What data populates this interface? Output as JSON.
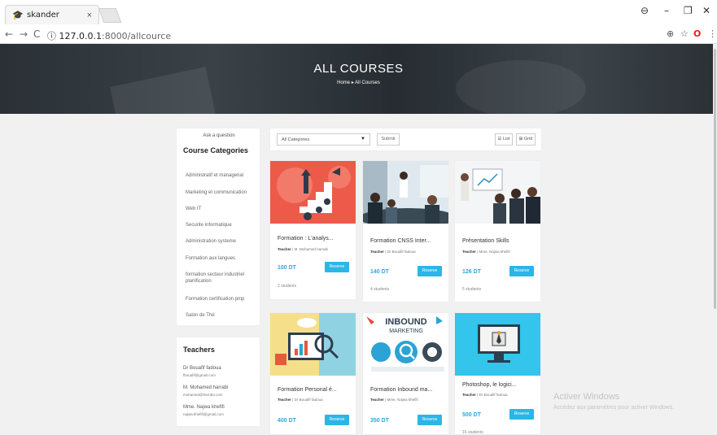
{
  "browser": {
    "tab_title": "skander",
    "tab_close": "×",
    "url_host": "127.0.0.1",
    "url_path": ":8000/allcource",
    "win_min": "–",
    "win_max": "❐",
    "win_close": "✕",
    "profile": "⊖"
  },
  "hero": {
    "title": "ALL COURSES",
    "breadcrumb_home": "Home",
    "breadcrumb_sep": "▸",
    "breadcrumb_current": "All Courses"
  },
  "sidebar": {
    "ask": "Ask a question",
    "categories_title": "Course Categories",
    "categories": [
      "Administratif et managerial",
      "Marketing et communication",
      "Web IT",
      "Securite informatique",
      "Administration systeme",
      "Formation aux langues",
      "formation secteur industriel planification",
      "Formation certification pmp",
      "Salon de Thé"
    ],
    "teachers_title": "Teachers",
    "teachers": [
      {
        "name": "Dr Bouafif fadoua",
        "email": "fbouafif@gmail.com"
      },
      {
        "name": "M. Mohamed harrabi",
        "email": "mohamed@harrabi.com"
      },
      {
        "name": "Mme. Najwa khefifi",
        "email": "najwa.khefifi@gmail.com"
      }
    ]
  },
  "filters": {
    "category_selected": "All Categories",
    "submit_label": "Submit",
    "list_label": "☰ List",
    "grid_label": "⊞ Grid"
  },
  "courses": [
    {
      "title": "Formation : L'analys...",
      "teacher": "M. Mohamed harrabi",
      "price": "100 DT",
      "students": "2 students"
    },
    {
      "title": "Formation CNSS Inter...",
      "teacher": "Dr Bouafif fadoua",
      "price": "140 DT",
      "students": "4 students"
    },
    {
      "title": "Présentation Skills",
      "teacher": "Mme. Najwa khefifi",
      "price": "126 DT",
      "students": "5 students"
    },
    {
      "title": "Formation Personal é...",
      "teacher": "Dr Bouafif fadoua",
      "price": "400 DT",
      "students": ""
    },
    {
      "title": "Formation Inbound ma...",
      "teacher": "Mme. Najwa khefifi",
      "price": "350 DT",
      "students": ""
    },
    {
      "title": "Photoshop, le logici...",
      "teacher": "Dr Bouafif fadoua",
      "price": "500 DT",
      "students": "16 students"
    }
  ],
  "course_labels": {
    "teacher_prefix": "Teacher",
    "reserve": "Reserve",
    "inbound_line1": "INBOUND",
    "inbound_line2": "MARKETING"
  },
  "windows_watermark": {
    "line1": "Activer Windows",
    "line2": "Accédez aux paramètres pour activer Windows."
  },
  "colors": {
    "accent": "#2bb6e6",
    "price": "#2aa8dc"
  }
}
